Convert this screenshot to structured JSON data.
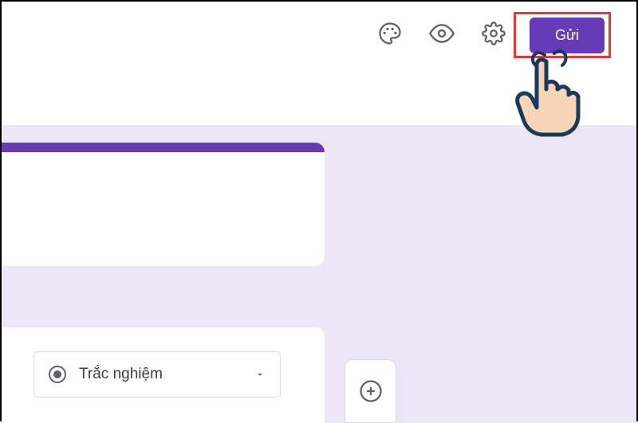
{
  "header": {
    "send_label": "Gửi"
  },
  "question": {
    "type_label": "Trắc nghiệm"
  },
  "colors": {
    "primary": "#673ab7",
    "highlight": "#e53935",
    "icon": "#5f6368",
    "canvas_bg": "#ece6f6"
  }
}
